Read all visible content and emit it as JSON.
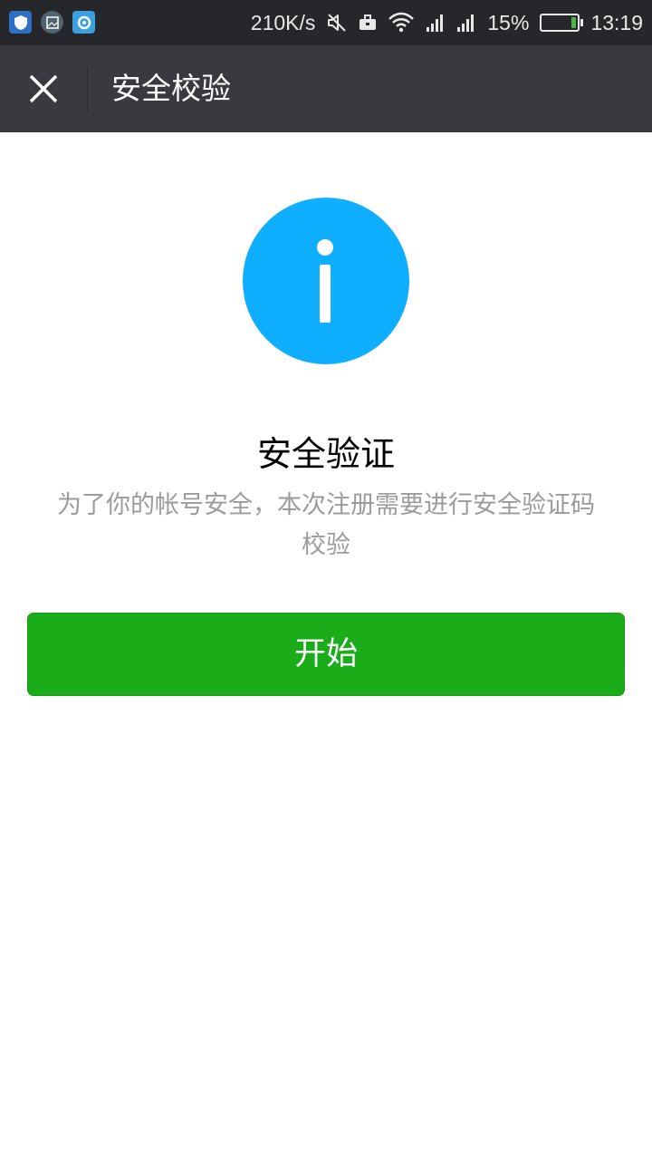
{
  "status_bar": {
    "net_speed": "210K/s",
    "battery_percent": "15%",
    "battery_level": 0.15,
    "time": "13:19",
    "notification_icons": [
      "shield-app-icon",
      "image-app-icon",
      "browser-app-icon"
    ],
    "system_icons": [
      "mute-icon",
      "briefcase-icon",
      "wifi-icon",
      "signal-icon",
      "signal-icon"
    ]
  },
  "nav": {
    "title": "安全校验",
    "close_icon": "close-icon"
  },
  "content": {
    "icon": "info-icon",
    "title": "安全验证",
    "description": "为了你的帐号安全，本次注册需要进行安全验证码校验"
  },
  "actions": {
    "start_label": "开始"
  },
  "colors": {
    "status_bar_bg": "#26272b",
    "nav_bg": "#393a3f",
    "info_blue": "#10aeff",
    "primary_green": "#1aad19",
    "desc_gray": "#9b9b9b"
  }
}
